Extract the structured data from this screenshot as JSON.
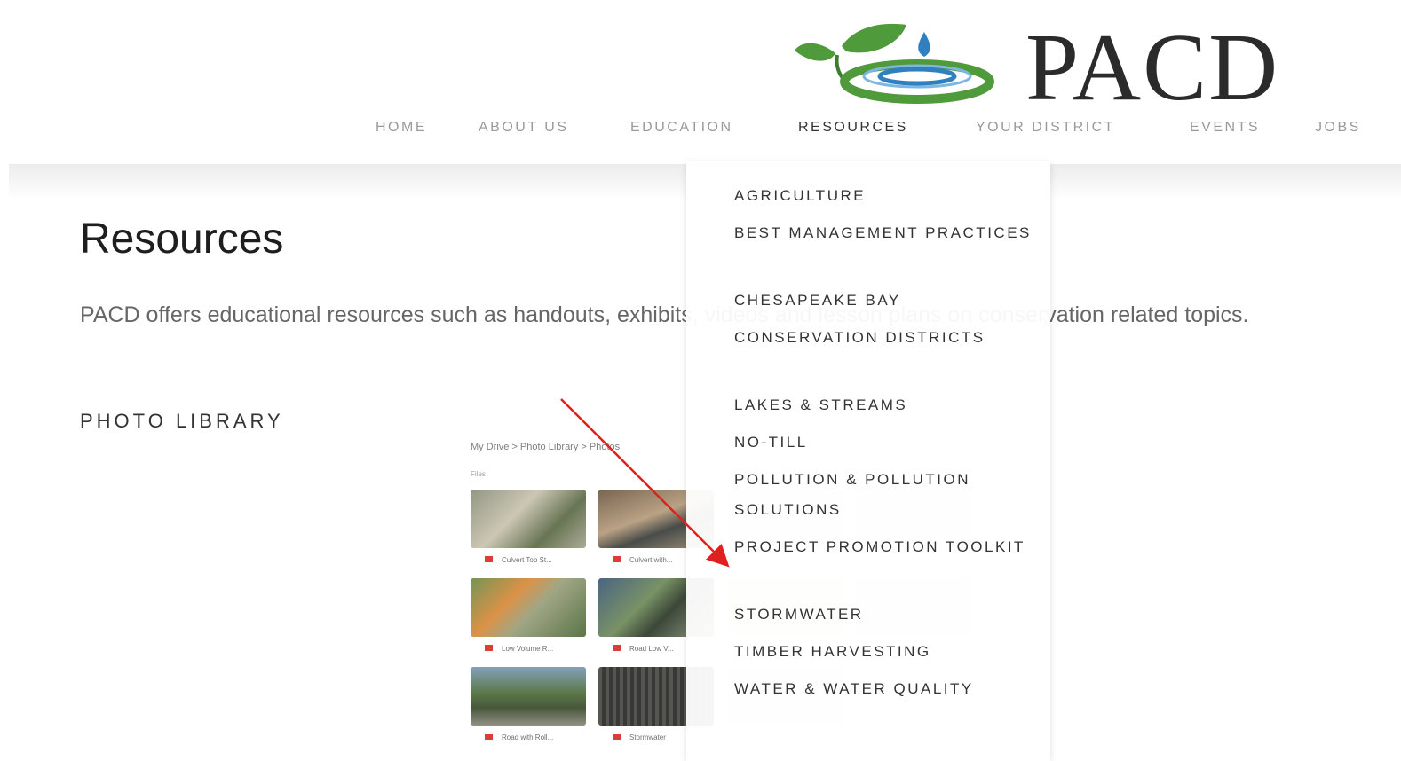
{
  "header": {
    "logo_text": "PACD"
  },
  "nav": {
    "items": [
      {
        "label": "HOME"
      },
      {
        "label": "ABOUT US"
      },
      {
        "label": "EDUCATION"
      },
      {
        "label": "RESOURCES"
      },
      {
        "label": "YOUR DISTRICT"
      },
      {
        "label": "EVENTS"
      },
      {
        "label": "JOBS"
      }
    ],
    "active": "RESOURCES"
  },
  "main": {
    "title": "Resources",
    "intro": "PACD offers educational resources such as handouts, exhibits, videos and lesson plans on conservation related topics.",
    "section_heading": "PHOTO LIBRARY"
  },
  "photo_library_screenshot": {
    "breadcrumb": "My Drive  >  Photo Library  >  Photos",
    "files_label": "Files",
    "thumb_captions": [
      "Culvert Top St...",
      "Culvert with...",
      "Low Volume R...",
      "Road Low V...",
      "Road with Roll...",
      "Stormwater"
    ]
  },
  "dropdown": {
    "items": [
      {
        "label": "AGRICULTURE"
      },
      {
        "label": "BEST MANAGEMENT PRACTICES"
      },
      {
        "label": "CHESAPEAKE BAY"
      },
      {
        "label": "CONSERVATION DISTRICTS"
      },
      {
        "label": "LAKES & STREAMS"
      },
      {
        "label": "NO-TILL"
      },
      {
        "label": "POLLUTION & POLLUTION SOLUTIONS"
      },
      {
        "label": "PROJECT PROMOTION TOOLKIT"
      },
      {
        "label": "STORMWATER"
      },
      {
        "label": "TIMBER HARVESTING"
      },
      {
        "label": "WATER & WATER QUALITY"
      }
    ]
  },
  "colors": {
    "logo_green": "#4f9a3a",
    "logo_blue": "#2f7fc1",
    "annotation_arrow": "#e02020"
  }
}
